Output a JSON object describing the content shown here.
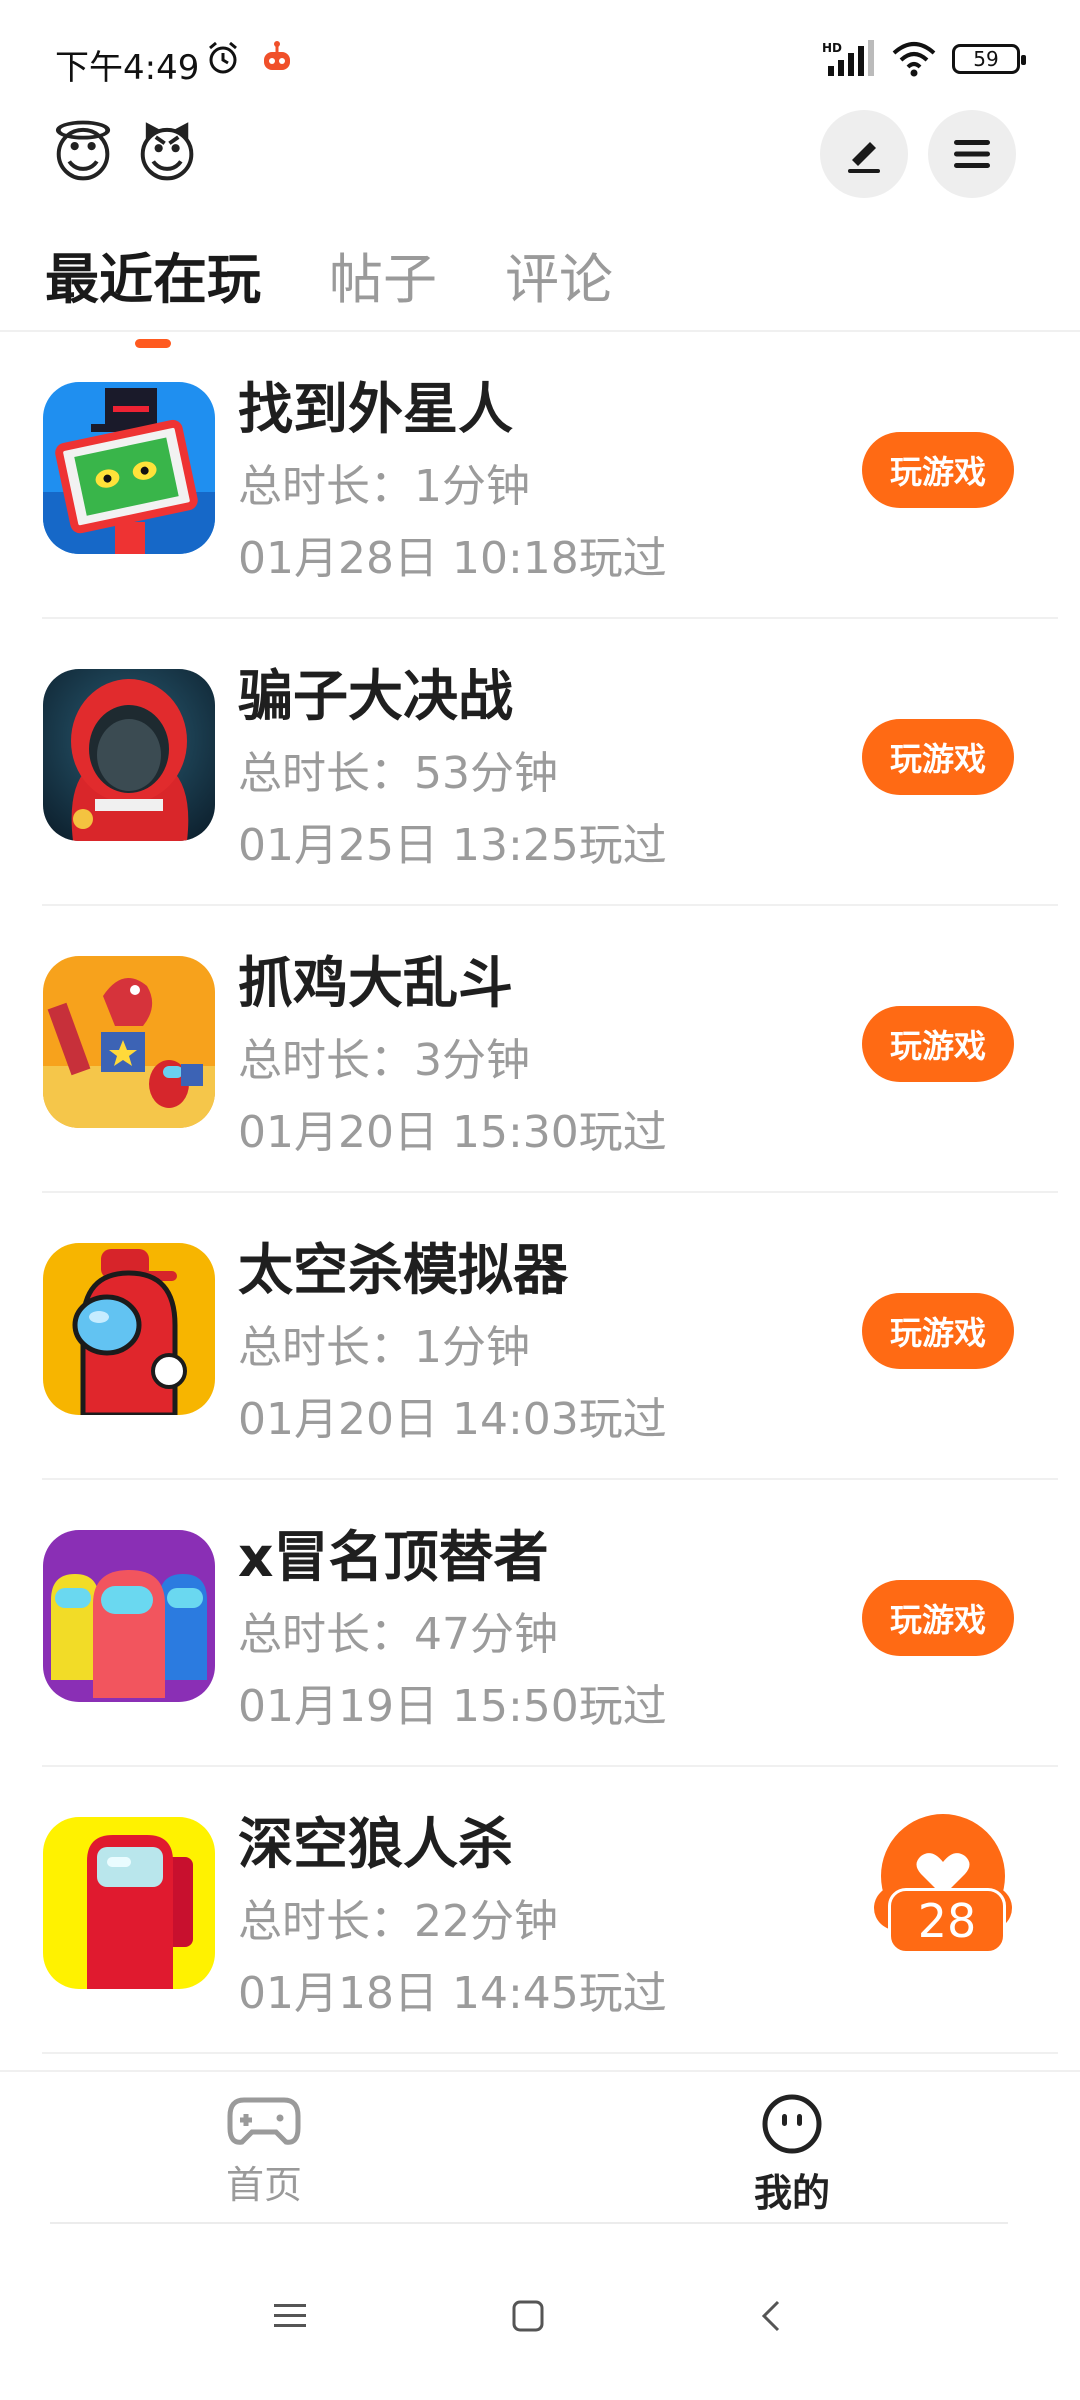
{
  "status_bar": {
    "time": "下午4:49",
    "network": "HD",
    "battery": "59"
  },
  "header": {
    "avatars": [
      "😇",
      "😈"
    ]
  },
  "tabs": [
    {
      "label": "最近在玩",
      "active": true
    },
    {
      "label": "帖子",
      "active": false
    },
    {
      "label": "评论",
      "active": false
    }
  ],
  "games": [
    {
      "title": "找到外星人",
      "duration": "总时长：1分钟",
      "last_played": "01月28日 10:18玩过",
      "play_label": "玩游戏"
    },
    {
      "title": "骗子大决战",
      "duration": "总时长：53分钟",
      "last_played": "01月25日 13:25玩过",
      "play_label": "玩游戏"
    },
    {
      "title": "抓鸡大乱斗",
      "duration": "总时长：3分钟",
      "last_played": "01月20日 15:30玩过",
      "play_label": "玩游戏"
    },
    {
      "title": "太空杀模拟器",
      "duration": "总时长：1分钟",
      "last_played": "01月20日 14:03玩过",
      "play_label": "玩游戏"
    },
    {
      "title": "x冒名顶替者",
      "duration": "总时长：47分钟",
      "last_played": "01月19日 15:50玩过",
      "play_label": "玩游戏"
    },
    {
      "title": "深空狼人杀",
      "duration": "总时长：22分钟",
      "last_played": "01月18日 14:45玩过",
      "play_label": ""
    }
  ],
  "like_badge": {
    "count": "28"
  },
  "bottom_nav": {
    "home_label": "首页",
    "mine_label": "我的"
  },
  "colors": {
    "accent": "#ff6a14",
    "tab_indicator": "#ff5a1f"
  }
}
